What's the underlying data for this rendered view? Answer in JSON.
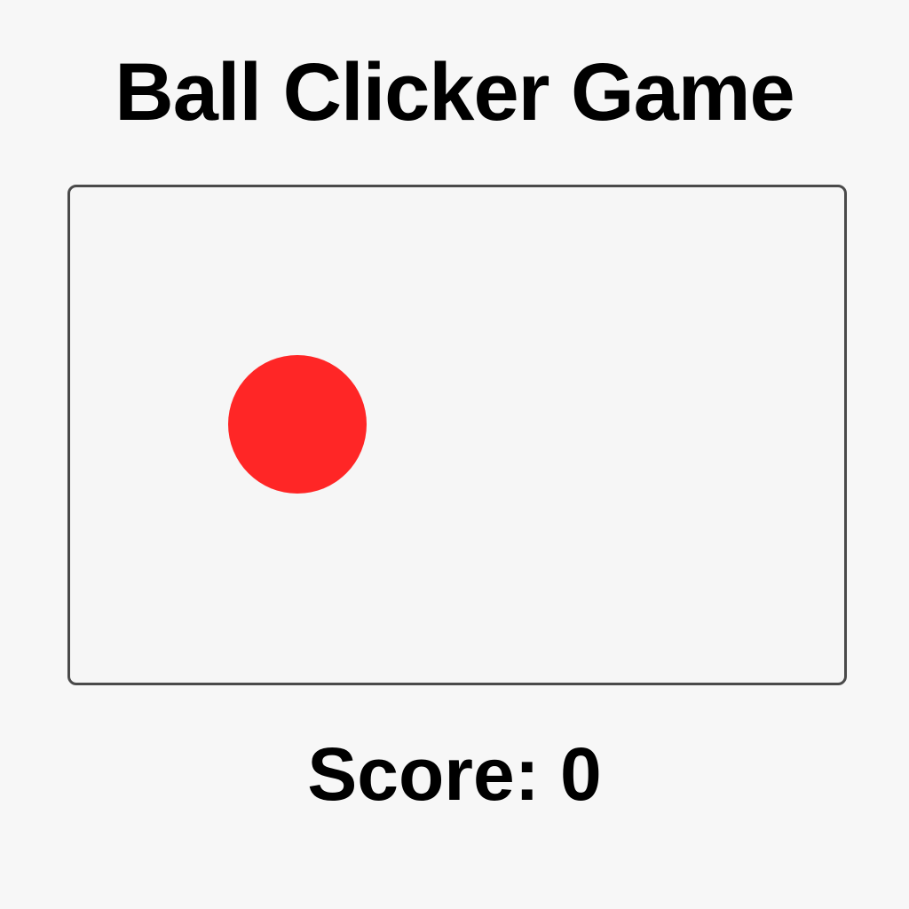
{
  "game": {
    "title": "Ball Clicker Game",
    "score_text": "Score: 0",
    "ball_color": "#ff2626"
  }
}
